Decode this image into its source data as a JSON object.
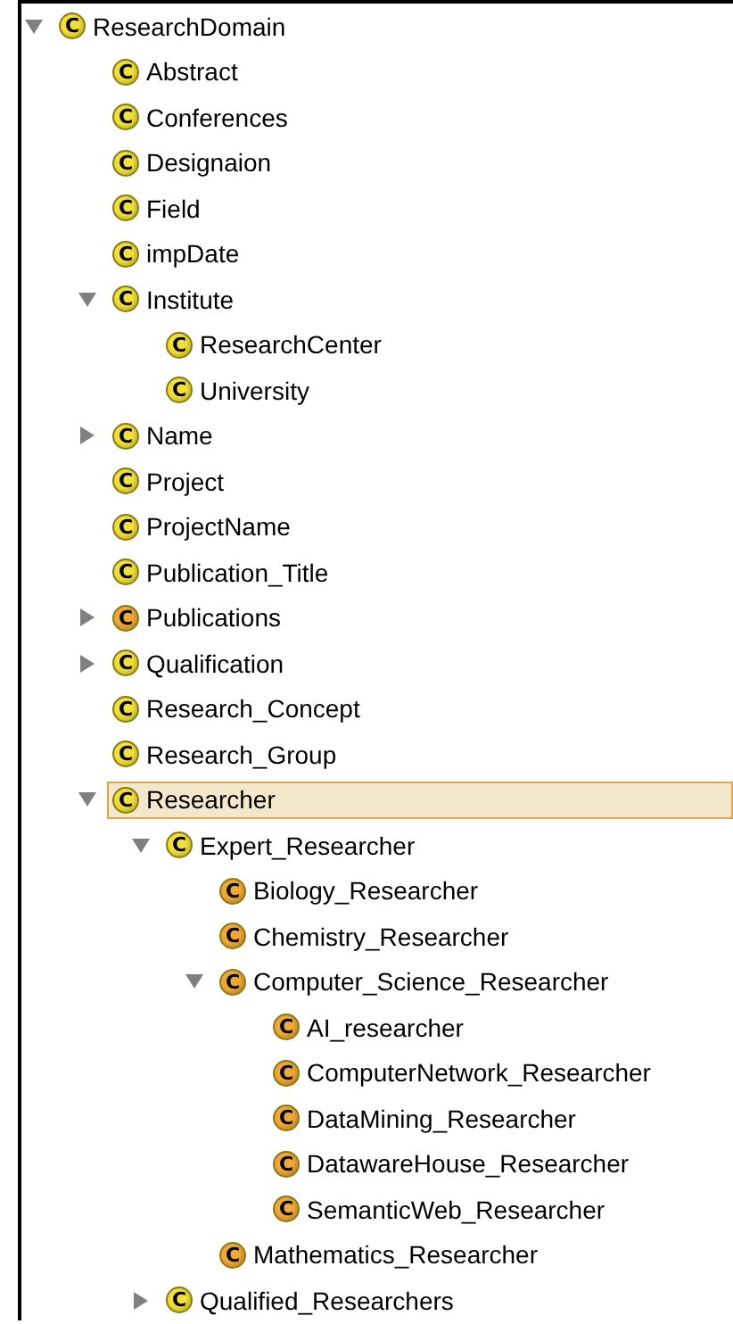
{
  "class_tree": {
    "nodes": [
      {
        "label": "ResearchDomain",
        "badge": "C",
        "color": "#f2e03a",
        "expanded": true,
        "selected": false,
        "children": [
          {
            "label": "Abstract",
            "badge": "C",
            "color": "#f2e03a",
            "selected": false
          },
          {
            "label": "Conferences",
            "badge": "C",
            "color": "#f2e03a",
            "selected": false
          },
          {
            "label": "Designaion",
            "badge": "C",
            "color": "#f2e03a",
            "selected": false
          },
          {
            "label": "Field",
            "badge": "C",
            "color": "#f2e03a",
            "selected": false
          },
          {
            "label": "impDate",
            "badge": "C",
            "color": "#f2e03a",
            "selected": false
          },
          {
            "label": "Institute",
            "badge": "C",
            "color": "#f2e03a",
            "expanded": true,
            "selected": false,
            "children": [
              {
                "label": "ResearchCenter",
                "badge": "C",
                "color": "#f2e03a",
                "selected": false
              },
              {
                "label": "University",
                "badge": "C",
                "color": "#f2e03a",
                "selected": false
              }
            ]
          },
          {
            "label": "Name",
            "badge": "C",
            "color": "#f2e03a",
            "expanded": false,
            "selected": false
          },
          {
            "label": "Project",
            "badge": "C",
            "color": "#f2e03a",
            "selected": false
          },
          {
            "label": "ProjectName",
            "badge": "C",
            "color": "#f2e03a",
            "selected": false
          },
          {
            "label": "Publication_Title",
            "badge": "C",
            "color": "#f2e03a",
            "selected": false
          },
          {
            "label": "Publications",
            "badge": "C",
            "color": "#f0a838",
            "expanded": false,
            "selected": false
          },
          {
            "label": "Qualification",
            "badge": "C",
            "color": "#f2e03a",
            "expanded": false,
            "selected": false
          },
          {
            "label": "Research_Concept",
            "badge": "C",
            "color": "#f2e03a",
            "selected": false
          },
          {
            "label": "Research_Group",
            "badge": "C",
            "color": "#f2e03a",
            "selected": false
          },
          {
            "label": "Researcher",
            "badge": "C",
            "color": "#f2e03a",
            "expanded": true,
            "selected": true,
            "children": [
              {
                "label": "Expert_Researcher",
                "badge": "C",
                "color": "#f2e03a",
                "expanded": true,
                "selected": false,
                "children": [
                  {
                    "label": "Biology_Researcher",
                    "badge": "C",
                    "color": "#f0a838",
                    "selected": false
                  },
                  {
                    "label": "Chemistry_Researcher",
                    "badge": "C",
                    "color": "#f0a838",
                    "selected": false
                  },
                  {
                    "label": "Computer_Science_Researcher",
                    "badge": "C",
                    "color": "#f0a838",
                    "expanded": true,
                    "selected": false,
                    "children": [
                      {
                        "label": "AI_researcher",
                        "badge": "C",
                        "color": "#f0a838",
                        "selected": false
                      },
                      {
                        "label": "ComputerNetwork_Researcher",
                        "badge": "C",
                        "color": "#f0a838",
                        "selected": false
                      },
                      {
                        "label": "DataMining_Researcher",
                        "badge": "C",
                        "color": "#f0a838",
                        "selected": false
                      },
                      {
                        "label": "DatawareHouse_Researcher",
                        "badge": "C",
                        "color": "#f0a838",
                        "selected": false
                      },
                      {
                        "label": "SemanticWeb_Researcher",
                        "badge": "C",
                        "color": "#f0a838",
                        "selected": false
                      }
                    ]
                  },
                  {
                    "label": "Mathematics_Researcher",
                    "badge": "C",
                    "color": "#f0a838",
                    "selected": false
                  }
                ]
              },
              {
                "label": "Qualified_Researchers",
                "badge": "C",
                "color": "#f2e03a",
                "expanded": false,
                "selected": false
              }
            ]
          }
        ]
      }
    ]
  }
}
